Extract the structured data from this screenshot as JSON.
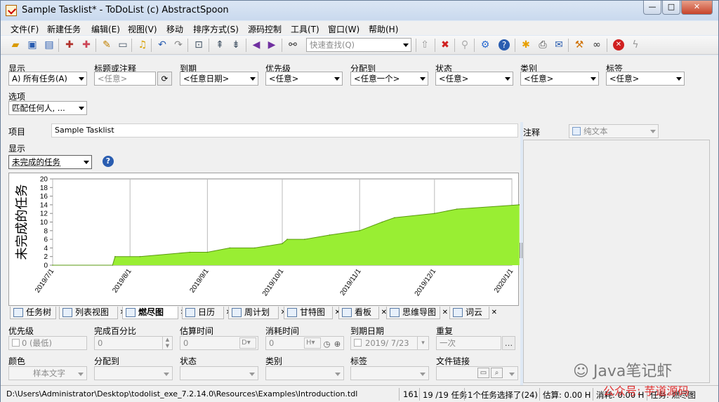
{
  "window": {
    "title": "Sample Tasklist* - ToDoList (c) AbstractSpoon"
  },
  "menu": [
    "文件(F)",
    "新建任务",
    "编辑(E)",
    "视图(V)",
    "移动",
    "排序方式(S)",
    "源码控制",
    "工具(T)",
    "窗口(W)",
    "帮助(H)"
  ],
  "toolbar": {
    "quick_find_placeholder": "快速查找(Q)"
  },
  "filters": {
    "show_label": "显示",
    "show_value": "A)  所有任务(A)",
    "title_label": "标题或注释",
    "title_placeholder": "<任意>",
    "due_label": "到期",
    "due_value": "<任意日期>",
    "priority_label": "优先级",
    "priority_value": "<任意>",
    "assigned_label": "分配到",
    "assigned_value": "<任意一个>",
    "status_label": "状态",
    "status_value": "<任意>",
    "category_label": "类别",
    "category_value": "<任意>",
    "tag_label": "标签",
    "tag_value": "<任意>",
    "options_label": "选项",
    "options_value": "匹配任何人, ..."
  },
  "project": {
    "label": "项目",
    "value": "Sample Tasklist"
  },
  "display": {
    "label": "显示",
    "value": "未完成的任务"
  },
  "notes": {
    "label": "注释",
    "format": "纯文本"
  },
  "chart_data": {
    "type": "area",
    "ylabel": "未完成的任务",
    "ylim": [
      0,
      20
    ],
    "yticks": [
      "20",
      "18",
      "16",
      "14",
      "12",
      "10",
      "8",
      "6",
      "4",
      "2",
      "0"
    ],
    "x_tick_labels": [
      "2019/7/1",
      "2019/8/1",
      "2019/9/1",
      "2019/10/1",
      "2019/11/1",
      "2019/12/1",
      "2020/1/1"
    ],
    "grid": true,
    "color": "#99ee33",
    "x": [
      "2019/7/1",
      "2019/7/25",
      "2019/7/26",
      "2019/8/5",
      "2019/8/25",
      "2019/9/1",
      "2019/9/10",
      "2019/9/20",
      "2019/10/1",
      "2019/10/3",
      "2019/10/10",
      "2019/10/20",
      "2019/11/1",
      "2019/11/10",
      "2019/11/15",
      "2019/12/1",
      "2019/12/10",
      "2020/1/4"
    ],
    "values": [
      0,
      0,
      2,
      2,
      3,
      3,
      4,
      4,
      5,
      6,
      6,
      7,
      8,
      10,
      11,
      12,
      13,
      14
    ]
  },
  "view_tabs": [
    {
      "label": "任务树"
    },
    {
      "label": "列表视图"
    },
    {
      "label": "燃尽图"
    },
    {
      "label": "日历"
    },
    {
      "label": "周计划"
    },
    {
      "label": "甘特图"
    },
    {
      "label": "看板"
    },
    {
      "label": "思维导图"
    },
    {
      "label": "词云"
    }
  ],
  "attrs": {
    "priority_label": "优先级",
    "priority_value": "0 (最低)",
    "percent_label": "完成百分比",
    "percent_value": "0",
    "est_label": "估算时间",
    "est_value": "0",
    "est_unit": "D",
    "spent_label": "消耗时间",
    "spent_value": "0",
    "spent_unit": "H",
    "due_label": "到期日期",
    "due_value": "2019/  7/23",
    "recur_label": "重复",
    "recur_value": "一次",
    "color_label": "颜色",
    "color_value": "样本文字",
    "assigned_label": "分配到",
    "status_label": "状态",
    "category_label": "类别",
    "tag_label": "标签",
    "link_label": "文件链接"
  },
  "status": {
    "path": "D:\\Users\\Administrator\\Desktop\\todolist_exe_7.2.14.0\\Resources\\Examples\\Introduction.tdl",
    "count": "161",
    "tasks": "19 /19 任务",
    "selected": "1个任务选择了(24)",
    "estimate": "估算: 0.00 H",
    "spent": "消耗: 0.00 H",
    "view": "任务: 燃尽图"
  },
  "watermark": {
    "brand": "Java笔记虾",
    "sub": "公众号: 芋道源码"
  }
}
